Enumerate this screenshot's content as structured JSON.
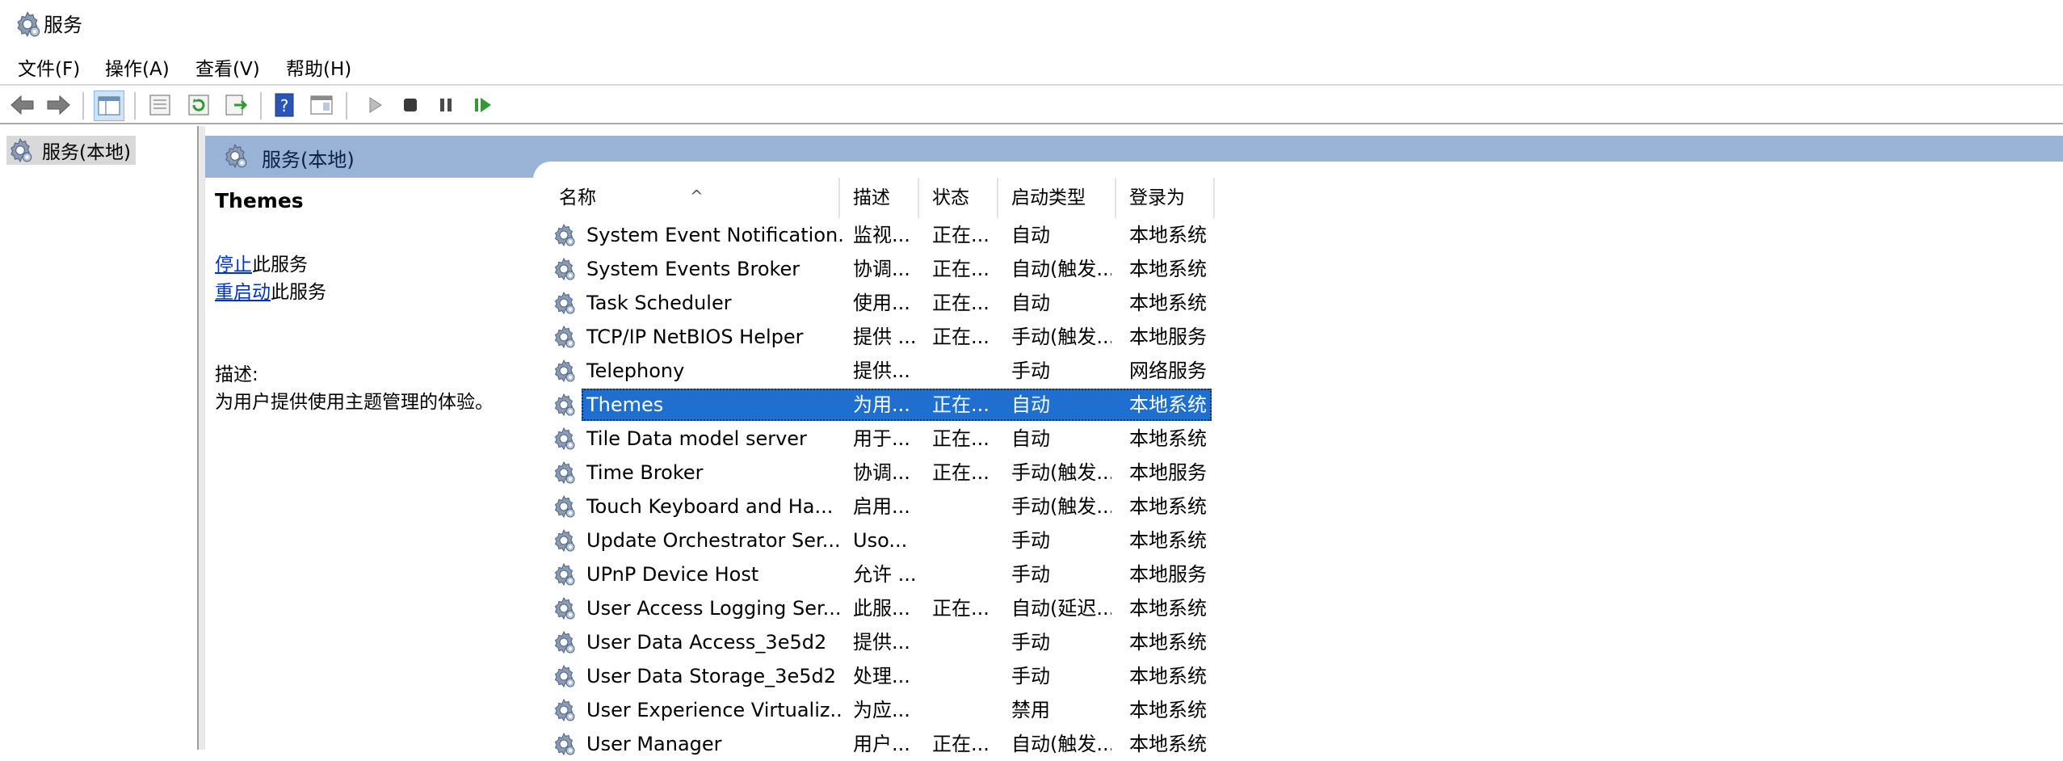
{
  "window": {
    "title": "服务"
  },
  "menu": [
    "文件(F)",
    "操作(A)",
    "查看(V)",
    "帮助(H)"
  ],
  "toolbar": {
    "icons": [
      "back-arrow-icon",
      "forward-arrow-icon",
      "show-hide-console-tree-icon",
      "properties-icon",
      "refresh-icon",
      "export-list-icon",
      "help-icon",
      "show-hide-action-pane-icon",
      "start-service-icon",
      "stop-service-icon",
      "pause-service-icon",
      "resume-service-icon"
    ]
  },
  "tree": {
    "root_label": "服务(本地)"
  },
  "panel": {
    "header_title": "服务(本地)"
  },
  "details": {
    "service_name": "Themes",
    "stop_link": "停止",
    "stop_suffix": "此服务",
    "restart_link": "重启动",
    "restart_suffix": "此服务",
    "description_label": "描述:",
    "description_text": "为用户提供使用主题管理的体验。"
  },
  "columns": [
    "名称",
    "描述",
    "状态",
    "启动类型",
    "登录为"
  ],
  "sort_indicator": "^",
  "services": [
    {
      "name": "System Event Notification...",
      "desc": "监视...",
      "status": "正在...",
      "startup": "自动",
      "logon": "本地系统"
    },
    {
      "name": "System Events Broker",
      "desc": "协调...",
      "status": "正在...",
      "startup": "自动(触发...",
      "logon": "本地系统"
    },
    {
      "name": "Task Scheduler",
      "desc": "使用...",
      "status": "正在...",
      "startup": "自动",
      "logon": "本地系统"
    },
    {
      "name": "TCP/IP NetBIOS Helper",
      "desc": "提供 ...",
      "status": "正在...",
      "startup": "手动(触发...",
      "logon": "本地服务"
    },
    {
      "name": "Telephony",
      "desc": "提供...",
      "status": "",
      "startup": "手动",
      "logon": "网络服务"
    },
    {
      "name": "Themes",
      "desc": "为用...",
      "status": "正在...",
      "startup": "自动",
      "logon": "本地系统",
      "selected": true
    },
    {
      "name": "Tile Data model server",
      "desc": "用于...",
      "status": "正在...",
      "startup": "自动",
      "logon": "本地系统"
    },
    {
      "name": "Time Broker",
      "desc": "协调...",
      "status": "正在...",
      "startup": "手动(触发...",
      "logon": "本地服务"
    },
    {
      "name": "Touch Keyboard and Ha...",
      "desc": "启用...",
      "status": "",
      "startup": "手动(触发...",
      "logon": "本地系统"
    },
    {
      "name": "Update Orchestrator Ser...",
      "desc": "Uso...",
      "status": "",
      "startup": "手动",
      "logon": "本地系统"
    },
    {
      "name": "UPnP Device Host",
      "desc": "允许 ...",
      "status": "",
      "startup": "手动",
      "logon": "本地服务"
    },
    {
      "name": "User Access Logging Ser...",
      "desc": "此服...",
      "status": "正在...",
      "startup": "自动(延迟...",
      "logon": "本地系统"
    },
    {
      "name": "User Data Access_3e5d2",
      "desc": "提供...",
      "status": "",
      "startup": "手动",
      "logon": "本地系统"
    },
    {
      "name": "User Data Storage_3e5d2",
      "desc": "处理...",
      "status": "",
      "startup": "手动",
      "logon": "本地系统"
    },
    {
      "name": "User Experience Virtualiz...",
      "desc": "为应...",
      "status": "",
      "startup": "禁用",
      "logon": "本地系统"
    },
    {
      "name": "User Manager",
      "desc": "用户...",
      "status": "正在...",
      "startup": "自动(触发...",
      "logon": "本地系统"
    }
  ]
}
